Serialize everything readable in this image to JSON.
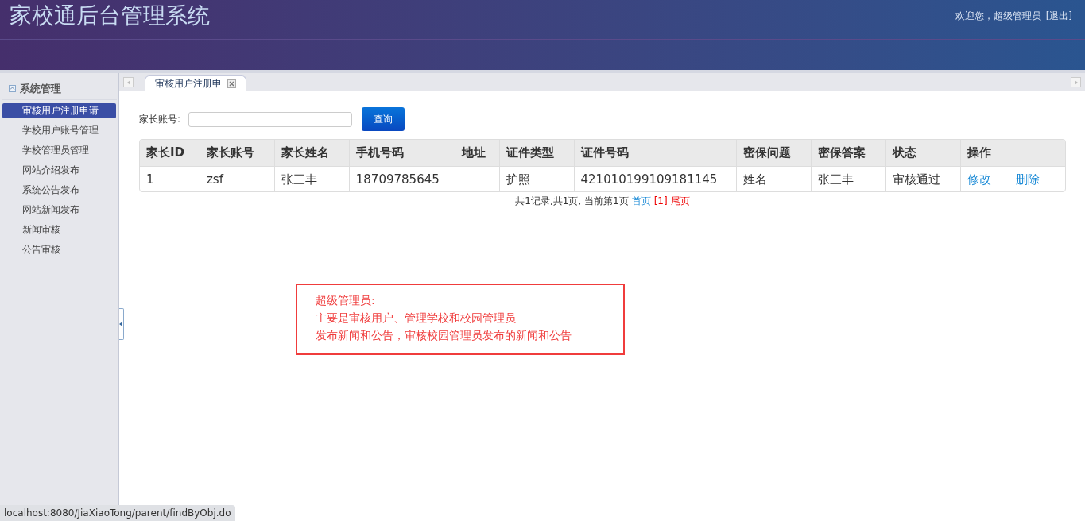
{
  "header": {
    "title": "家校通后台管理系统",
    "welcome": "欢迎您，超级管理员",
    "logout": "[退出]"
  },
  "sidebar": {
    "group": "系统管理",
    "items": [
      {
        "label": "审核用户注册申请",
        "selected": true
      },
      {
        "label": "学校用户账号管理",
        "selected": false
      },
      {
        "label": "学校管理员管理",
        "selected": false
      },
      {
        "label": "网站介绍发布",
        "selected": false
      },
      {
        "label": "系统公告发布",
        "selected": false
      },
      {
        "label": "网站新闻发布",
        "selected": false
      },
      {
        "label": "新闻审核",
        "selected": false
      },
      {
        "label": "公告审核",
        "selected": false
      }
    ]
  },
  "tabs": [
    {
      "label": "审核用户注册申",
      "selected": true
    }
  ],
  "search": {
    "label": "家长账号:",
    "button": "查询"
  },
  "table": {
    "columns": [
      "家长ID",
      "家长账号",
      "家长姓名",
      "手机号码",
      "地址",
      "证件类型",
      "证件号码",
      "密保问题",
      "密保答案",
      "状态",
      "操作"
    ],
    "rows": [
      {
        "cells": [
          "1",
          "zsf",
          "张三丰",
          "18709785645",
          "",
          "护照",
          "421010199109181145",
          "姓名",
          "张三丰",
          "审核通过"
        ],
        "actions": [
          "修改",
          "删除"
        ]
      }
    ]
  },
  "pagination": {
    "summary": "共1记录,共1页, 当前第1页",
    "first": "首页",
    "current": "[1]",
    "last": "尾页"
  },
  "annotation": [
    "超级管理员:",
    "主要是审核用户、管理学校和校园管理员",
    "发布新闻和公告，审核校园管理员发布的新闻和公告"
  ],
  "status_bar": "localhost:8080/JiaXiaoTong/parent/findByObj.do"
}
